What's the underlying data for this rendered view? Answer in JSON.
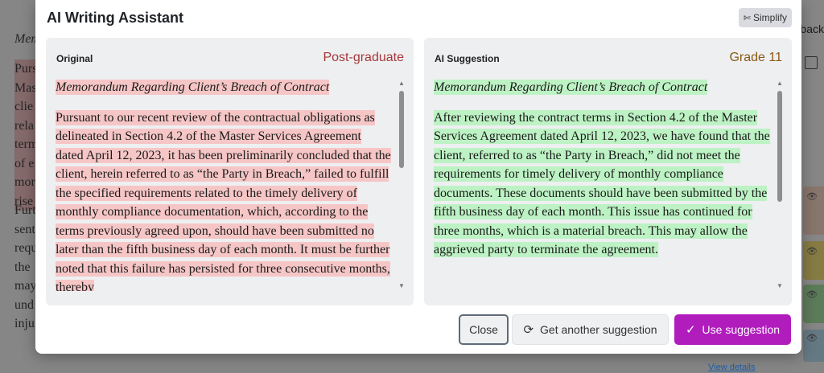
{
  "background": {
    "memo_heading": "Mem",
    "para1_lines": [
      "Purs",
      "Mas",
      "clie",
      "rela",
      "term",
      "of e",
      "mor",
      "rise"
    ],
    "para2_lines": [
      "Furt",
      "sent",
      "requ",
      "the",
      "may",
      "und",
      "inju"
    ],
    "back_label": "back",
    "view_details": "View details"
  },
  "modal": {
    "title": "AI Writing Assistant",
    "simplify_label": "Simplify",
    "original": {
      "label": "Original",
      "level": "Post-graduate",
      "doc_title": "Memorandum Regarding Client’s Breach of Contract",
      "body": "Pursuant to our recent review of the contractual obligations as delineated in Section 4.2 of the Master Services Agreement dated April 12, 2023, it has been preliminarily concluded that the client, herein referred to as “the Party in Breach,” failed to fulfill the specified requirements related to the timely delivery of monthly compliance documentation, which, according to the terms previously agreed upon, should have been submitted no later than the fifth business day of each month. It must be further noted that this failure has persisted for three consecutive months, thereby"
    },
    "suggestion": {
      "label": "AI Suggestion",
      "level": "Grade 11",
      "doc_title": "Memorandum Regarding Client’s Breach of Contract",
      "body": "After reviewing the contract terms in Section 4.2 of the Master Services Agreement dated April 12, 2023, we have found that the client, referred to as “the Party in Breach,” did not meet the requirements for timely delivery of monthly compliance documents. These documents should have been submitted by the fifth business day of each month. This issue has continued for three months, which is a material breach. This may allow the aggrieved party to terminate the agreement."
    },
    "buttons": {
      "close": "Close",
      "another": "Get another suggestion",
      "use": "Use suggestion"
    }
  },
  "colors": {
    "accent": "#b11dbd",
    "original_highlight": "#f6c6c6",
    "suggestion_highlight": "#bdf2c4",
    "original_level": "#a53838",
    "suggestion_level": "#8a5a16"
  },
  "icons": {
    "simplify": "magic-wand-icon",
    "another": "refresh-icon",
    "use": "check-icon"
  }
}
